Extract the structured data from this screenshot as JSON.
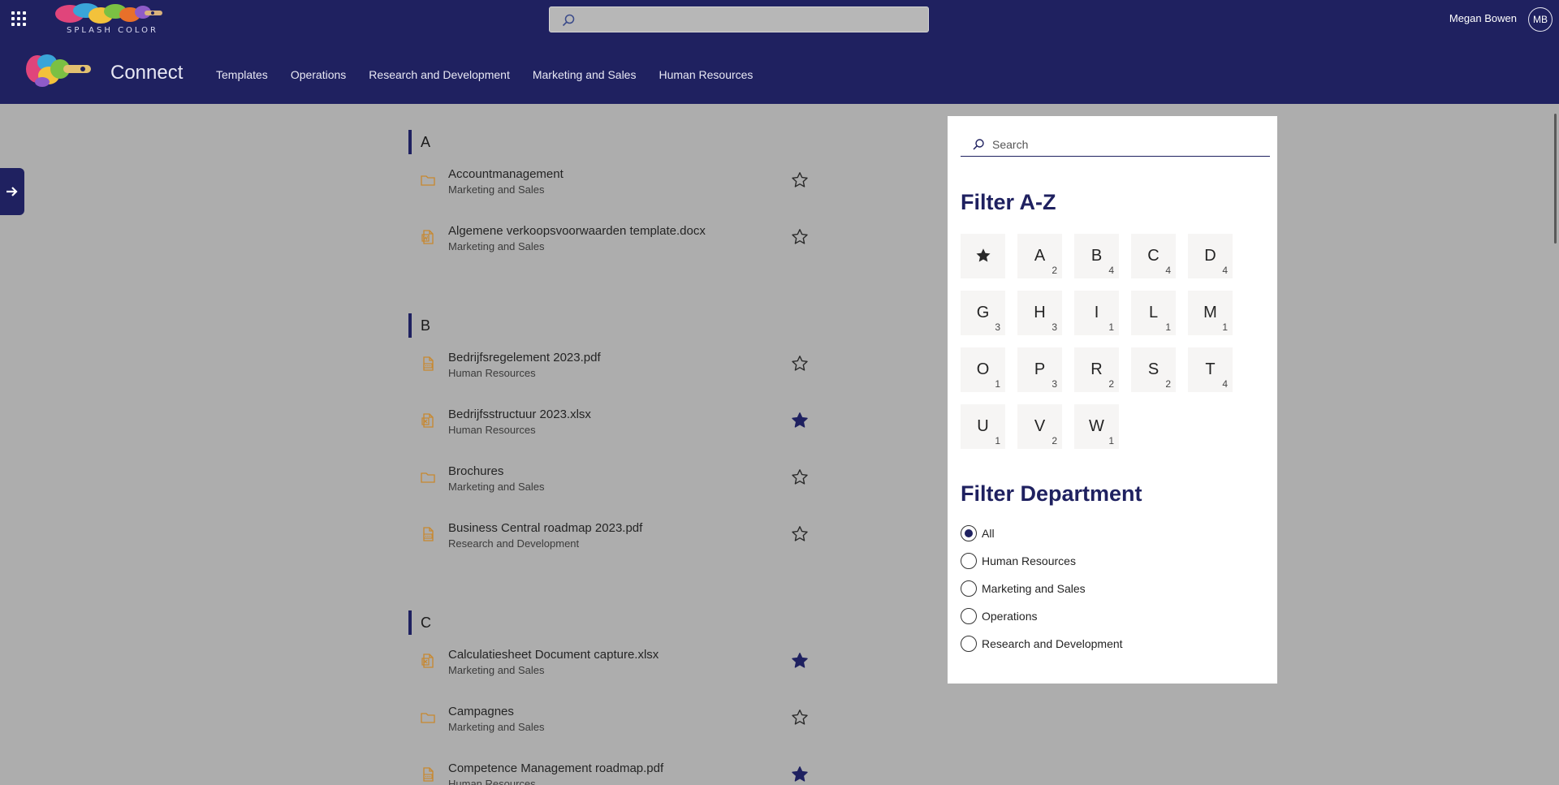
{
  "suite": {
    "logo_text": "SPLASH COLOR",
    "search_value": "",
    "user_name": "Megan Bowen",
    "user_initials": "MB"
  },
  "site": {
    "title": "Connect",
    "nav": [
      {
        "label": "Templates"
      },
      {
        "label": "Operations"
      },
      {
        "label": "Research and Development"
      },
      {
        "label": "Marketing and Sales"
      },
      {
        "label": "Human Resources"
      }
    ]
  },
  "list": {
    "groups": [
      {
        "letter": "A",
        "items": [
          {
            "title": "Accountmanagement",
            "dept": "Marketing and Sales",
            "icon": "folder-icon",
            "favorite": false
          },
          {
            "title": "Algemene verkoopsvoorwaarden template.docx",
            "dept": "Marketing and Sales",
            "icon": "word-file-icon",
            "favorite": false
          }
        ]
      },
      {
        "letter": "B",
        "items": [
          {
            "title": "Bedrijfsregelement 2023.pdf",
            "dept": "Human Resources",
            "icon": "pdf-file-icon",
            "favorite": false
          },
          {
            "title": "Bedrijfsstructuur 2023.xlsx",
            "dept": "Human Resources",
            "icon": "excel-file-icon",
            "favorite": true
          },
          {
            "title": "Brochures",
            "dept": "Marketing and Sales",
            "icon": "folder-icon",
            "favorite": false
          },
          {
            "title": "Business Central roadmap 2023.pdf",
            "dept": "Research and Development",
            "icon": "pdf-file-icon",
            "favorite": false
          }
        ]
      },
      {
        "letter": "C",
        "items": [
          {
            "title": "Calculatiesheet Document capture.xlsx",
            "dept": "Marketing and Sales",
            "icon": "excel-file-icon",
            "favorite": true
          },
          {
            "title": "Campagnes",
            "dept": "Marketing and Sales",
            "icon": "folder-icon",
            "favorite": false
          },
          {
            "title": "Competence Management roadmap.pdf",
            "dept": "Human Resources",
            "icon": "pdf-file-icon",
            "favorite": true
          }
        ]
      }
    ]
  },
  "filters": {
    "search_placeholder": "Search",
    "az_heading": "Filter A-Z",
    "tiles": [
      {
        "letter": "",
        "count": "",
        "star": true
      },
      {
        "letter": "A",
        "count": "2"
      },
      {
        "letter": "B",
        "count": "4"
      },
      {
        "letter": "C",
        "count": "4"
      },
      {
        "letter": "D",
        "count": "4"
      },
      {
        "letter": "G",
        "count": "3"
      },
      {
        "letter": "H",
        "count": "3"
      },
      {
        "letter": "I",
        "count": "1"
      },
      {
        "letter": "L",
        "count": "1"
      },
      {
        "letter": "M",
        "count": "1"
      },
      {
        "letter": "O",
        "count": "1"
      },
      {
        "letter": "P",
        "count": "3"
      },
      {
        "letter": "R",
        "count": "2"
      },
      {
        "letter": "S",
        "count": "2"
      },
      {
        "letter": "T",
        "count": "4"
      },
      {
        "letter": "U",
        "count": "1"
      },
      {
        "letter": "V",
        "count": "2"
      },
      {
        "letter": "W",
        "count": "1"
      }
    ],
    "dept_heading": "Filter Department",
    "departments": [
      {
        "label": "All",
        "selected": true
      },
      {
        "label": "Human Resources",
        "selected": false
      },
      {
        "label": "Marketing and Sales",
        "selected": false
      },
      {
        "label": "Operations",
        "selected": false
      },
      {
        "label": "Research and Development",
        "selected": false
      }
    ]
  },
  "colors": {
    "brand": "#1f2160",
    "overlay": "#adadad",
    "file_icon": "#c8882e"
  }
}
